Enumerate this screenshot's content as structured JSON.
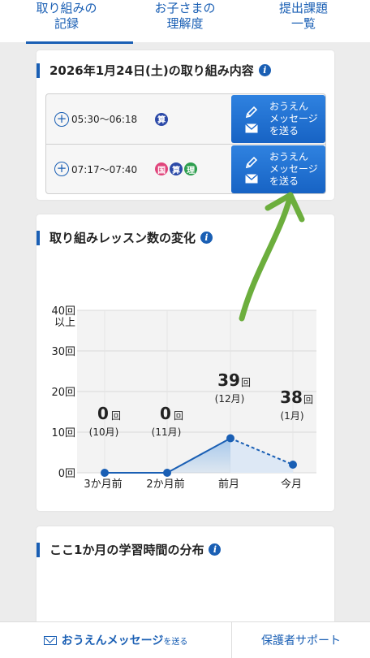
{
  "tabs": [
    {
      "line1": "取り組みの",
      "line2": "記録"
    },
    {
      "line1": "お子さまの",
      "line2": "理解度"
    },
    {
      "line1": "提出課題",
      "line2": "一覧"
    }
  ],
  "activity": {
    "title": "2026年1月24日(土)の取り組み内容",
    "rows": [
      {
        "time": "05:30〜06:18",
        "subjects": [
          {
            "label": "算",
            "color": "#2c4aa8"
          }
        ]
      },
      {
        "time": "07:17〜07:40",
        "subjects": [
          {
            "label": "国",
            "color": "#e0457b"
          },
          {
            "label": "算",
            "color": "#2c4aa8"
          },
          {
            "label": "理",
            "color": "#2e9e4f"
          }
        ]
      }
    ],
    "message_button": {
      "line1": "おうえん",
      "line2": "メッセージ",
      "line3": "を送る"
    }
  },
  "lessons": {
    "title": "取り組みレッスン数の変化"
  },
  "chart_data": {
    "type": "area",
    "categories": [
      "3か月前",
      "2か月前",
      "前月",
      "今月"
    ],
    "values": [
      0,
      0,
      39,
      38
    ],
    "month_labels": [
      "(10月)",
      "(11月)",
      "(12月)",
      "(1月)"
    ],
    "value_unit": "回",
    "y_ticks": [
      "0回",
      "10回",
      "20回",
      "30回",
      "40回"
    ],
    "y_top_suffix": "以上",
    "ylim": [
      0,
      40
    ],
    "plot_values": [
      0,
      0,
      8.5,
      2
    ],
    "current_month_dashed": true,
    "color": "#1a5fb4",
    "fill_color": "#9ec3ea"
  },
  "distribution": {
    "title": "ここ1か月の学習時間の分布"
  },
  "bottom": {
    "message_main": "おうえんメッセージ",
    "message_small": "を送る",
    "support": "保護者サポート"
  },
  "icons": [
    "info-icon",
    "plus-circle-icon",
    "pencil-icon",
    "envelope-icon"
  ]
}
